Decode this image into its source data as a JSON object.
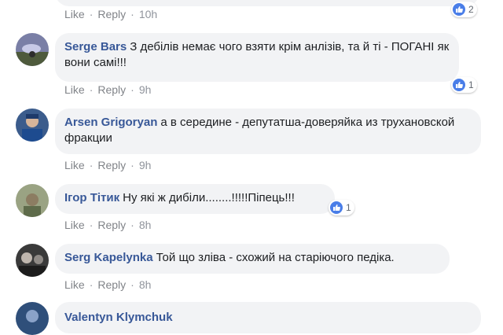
{
  "comments": [
    {
      "author": "",
      "text": "",
      "like_label": "Like",
      "reply_label": "Reply",
      "time": "10h",
      "reaction_count": "2"
    },
    {
      "author": "Serge Bars",
      "text": "З дебілів немає чого взяти крім анлізів, та й ті - ПОГАНІ як вони самі!!!",
      "like_label": "Like",
      "reply_label": "Reply",
      "time": "9h",
      "reaction_count": "1"
    },
    {
      "author": "Arsen Grigoryan",
      "text": "а в середине - депутатша-доверяйка из трухановской фракции",
      "like_label": "Like",
      "reply_label": "Reply",
      "time": "9h",
      "reaction_count": ""
    },
    {
      "author": "Ігор Тітик",
      "text": "Ну які ж дибіли........!!!!!Піпець!!!",
      "like_label": "Like",
      "reply_label": "Reply",
      "time": "8h",
      "reaction_count": "1"
    },
    {
      "author": "Serg Kapelynka",
      "text": "Той що зліва - схожий на старіючого педіка.",
      "like_label": "Like",
      "reply_label": "Reply",
      "time": "8h",
      "reaction_count": ""
    },
    {
      "author": "Valentyn Klymchuk",
      "text": "",
      "like_label": "",
      "reply_label": "",
      "time": "",
      "reaction_count": ""
    }
  ],
  "colors": {
    "author": "#385898",
    "bubble": "#f2f3f5",
    "meta": "#90949c",
    "like_icon": "#4a7ee8"
  }
}
